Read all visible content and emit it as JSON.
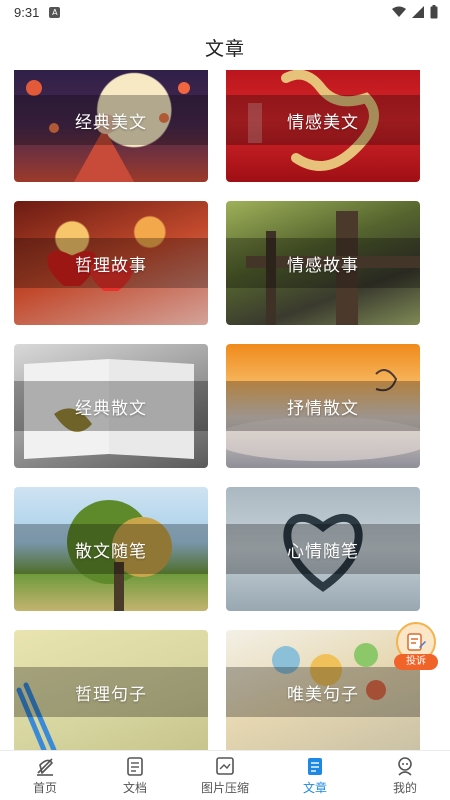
{
  "status_bar": {
    "time": "9:31",
    "notification_badge": "A"
  },
  "header": {
    "title": "文章"
  },
  "cards": [
    {
      "label": "经典美文"
    },
    {
      "label": "情感美文"
    },
    {
      "label": "哲理故事"
    },
    {
      "label": "情感故事"
    },
    {
      "label": "经典散文"
    },
    {
      "label": "抒情散文"
    },
    {
      "label": "散文随笔"
    },
    {
      "label": "心情随笔"
    },
    {
      "label": "哲理句子"
    },
    {
      "label": "唯美句子"
    }
  ],
  "float_button": {
    "label": "投诉"
  },
  "tabbar": {
    "items": [
      {
        "label": "首页",
        "icon": "home-icon"
      },
      {
        "label": "文档",
        "icon": "document-icon"
      },
      {
        "label": "图片压缩",
        "icon": "image-compress-icon"
      },
      {
        "label": "文章",
        "icon": "article-icon"
      },
      {
        "label": "我的",
        "icon": "profile-icon"
      }
    ],
    "active_index": 3,
    "active_color": "#1e88e5"
  }
}
